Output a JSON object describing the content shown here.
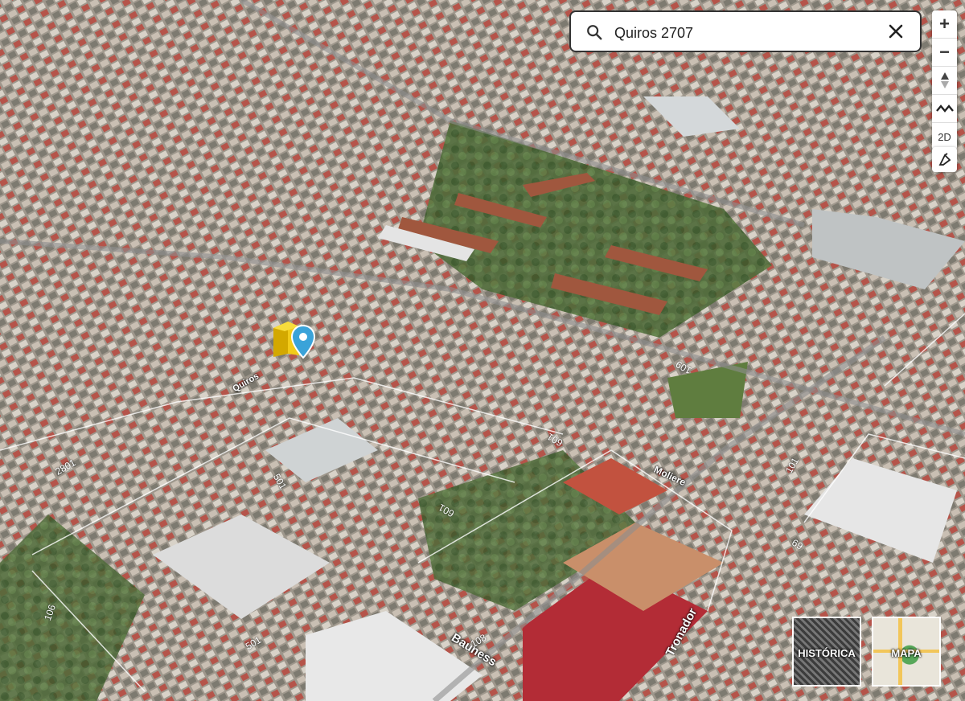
{
  "search": {
    "value": "Quiros 2707",
    "placeholder": ""
  },
  "controls": {
    "zoom_in": "+",
    "zoom_out": "−",
    "compass": "⬍",
    "terrain": "〰",
    "view_mode": "2D",
    "style": "✎"
  },
  "streets": [
    {
      "label": "Bauness"
    },
    {
      "label": "Tronador"
    },
    {
      "label": "Moliere"
    },
    {
      "label": "Quiros"
    }
  ],
  "block_numbers": [
    "2801",
    "106",
    "501",
    "601",
    "501",
    "601",
    "109",
    "101",
    "69",
    "108"
  ],
  "basemaps": {
    "historica": "HISTÓRICA",
    "mapa": "MAPA"
  },
  "marker_color": "#3aa3d9",
  "building_color": "#e0b400"
}
